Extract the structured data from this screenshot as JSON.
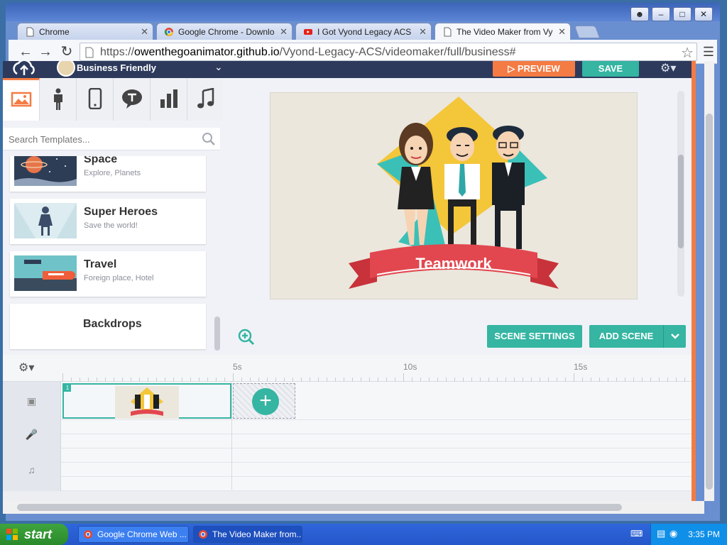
{
  "browser": {
    "tabs": [
      {
        "label": "Chrome",
        "icon": "page-icon",
        "active": false
      },
      {
        "label": "Google Chrome - Download",
        "icon": "chrome-icon",
        "active": false
      },
      {
        "label": "I Got Vyond Legacy ACS",
        "icon": "youtube-icon",
        "active": false
      },
      {
        "label": "The Video Maker from Vyond",
        "icon": "page-icon",
        "active": true
      }
    ],
    "url_prefix": "https://",
    "url_host": "owenthegoanimator.github.io",
    "url_path": "/Vyond-Legacy-ACS/videomaker/full/business#"
  },
  "app": {
    "theme_label": "Business Friendly",
    "preview_label": "PREVIEW",
    "save_label": "SAVE",
    "search_placeholder": "Search Templates...",
    "library_tabs": [
      "image-icon",
      "character-icon",
      "phone-icon",
      "text-bubble-icon",
      "chart-icon",
      "music-icon"
    ],
    "templates": [
      {
        "title": "Space",
        "subtitle": "Explore, Planets"
      },
      {
        "title": "Super Heroes",
        "subtitle": "Save the world!"
      },
      {
        "title": "Travel",
        "subtitle": "Foreign place, Hotel"
      },
      {
        "title": "Backdrops",
        "subtitle": ""
      }
    ],
    "scene_banner": "Teamwork",
    "scene_settings_label": "SCENE SETTINGS",
    "add_scene_label": "ADD SCENE",
    "timeline": {
      "ticks": [
        "5s",
        "10s",
        "15s"
      ],
      "scene_number": "1"
    }
  },
  "taskbar": {
    "start_label": "start",
    "tasks": [
      {
        "label": "Google Chrome Web ...",
        "active": false
      },
      {
        "label": "The Video Maker from...",
        "active": true
      }
    ],
    "clock": "3:35 PM"
  },
  "colors": {
    "accent_teal": "#35b5a2",
    "accent_orange": "#f47b43",
    "navy": "#2d3a5c"
  }
}
